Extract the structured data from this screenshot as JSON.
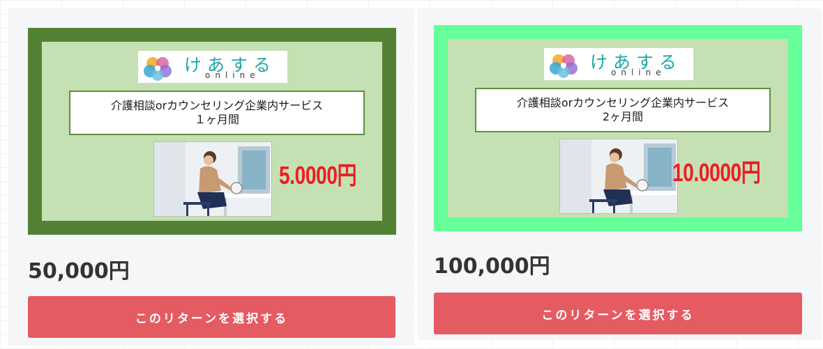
{
  "colors": {
    "accent_button": "#e55b62",
    "card_background": "#f4f6f8",
    "banner_inner": "#c5e0b3",
    "price_red": "#ee1c23",
    "logo_teal": "#1fa6a3"
  },
  "rewards": [
    {
      "frame_color": "#548235",
      "logo": {
        "name": "けあする",
        "sub": "online"
      },
      "banner_title_line1": "介護相談orカウンセリング企業内サービス",
      "banner_title_line2": "１ヶ月間",
      "banner_price": "5.0000円",
      "photo_icon": "woman-at-desk-photo",
      "price": "50,000円",
      "select_label": "このリターンを選択する"
    },
    {
      "frame_color": "#66ff99",
      "logo": {
        "name": "けあする",
        "sub": "online"
      },
      "banner_title_line1": "介護相談orカウンセリング企業内サービス",
      "banner_title_line2": "2ヶ月間",
      "banner_price": "10.0000円",
      "photo_icon": "woman-at-desk-photo",
      "price": "100,000円",
      "select_label": "このリターンを選択する"
    }
  ]
}
